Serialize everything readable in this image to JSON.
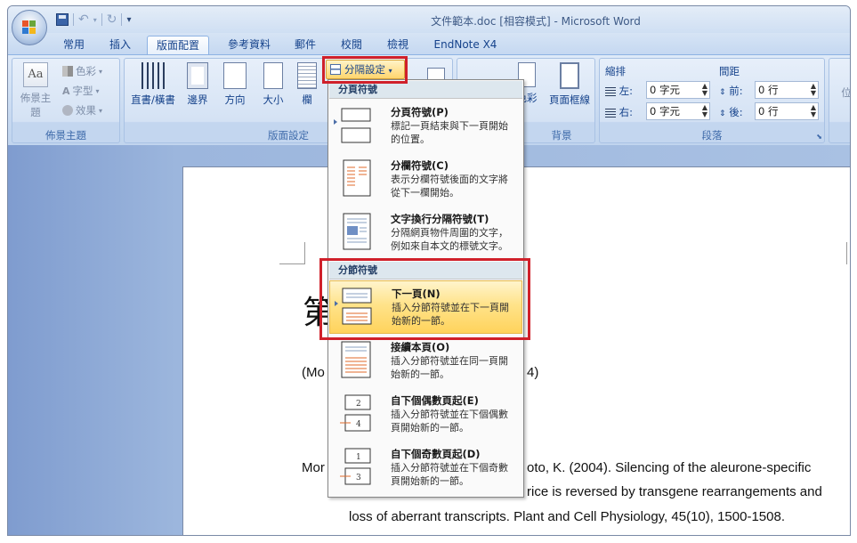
{
  "window": {
    "title": "文件範本.doc [相容模式] - Microsoft Word"
  },
  "qat": {
    "save_icon": "save-icon",
    "undo_icon": "undo-icon",
    "redo_icon": "redo-icon",
    "more": "▾"
  },
  "tabs": [
    {
      "label": "常用"
    },
    {
      "label": "插入"
    },
    {
      "label": "版面配置",
      "active": true
    },
    {
      "label": "參考資料"
    },
    {
      "label": "郵件"
    },
    {
      "label": "校閱"
    },
    {
      "label": "檢視"
    },
    {
      "label": "EndNote X4"
    }
  ],
  "ribbon": {
    "themes": {
      "label": "佈景主題",
      "theme_btn": "佈景主題",
      "colors": "色彩",
      "fonts": "字型",
      "effects": "效果"
    },
    "page_setup": {
      "label": "版面設定",
      "orientation": "直書/橫書",
      "margins": "邊界",
      "direction": "方向",
      "size": "大小",
      "columns": "欄",
      "breaks": "分隔設定"
    },
    "background": {
      "label": "背景",
      "page_color": "色彩",
      "page_borders": "頁面框線"
    },
    "paragraph": {
      "label": "段落",
      "indent_label": "縮排",
      "spacing_label": "間距",
      "left_label": "左:",
      "left_value": "0 字元",
      "right_label": "右:",
      "right_value": "0 字元",
      "before_label": "前:",
      "before_value": "0 行",
      "after_label": "後:",
      "after_value": "0 行"
    },
    "arrange_cut": "位"
  },
  "menu": {
    "page_breaks_header": "分頁符號",
    "section_breaks_header": "分節符號",
    "items": [
      {
        "title": "分頁符號(P)",
        "desc": "標記一頁結束與下一頁開始\n的位置。",
        "icon": "page-break-icon"
      },
      {
        "title": "分欄符號(C)",
        "desc": "表示分欄符號後面的文字將\n從下一欄開始。",
        "icon": "column-break-icon"
      },
      {
        "title": "文字換行分隔符號(T)",
        "desc": "分隔網頁物件周圍的文字，\n例如來自本文的標號文字。",
        "icon": "text-wrapping-break-icon"
      },
      {
        "title": "下一頁(N)",
        "desc": "插入分節符號並在下一頁開\n始新的一節。",
        "icon": "next-page-break-icon"
      },
      {
        "title": "接續本頁(O)",
        "desc": "插入分節符號並在同一頁開\n始新的一節。",
        "icon": "continuous-break-icon"
      },
      {
        "title": "自下個偶數頁起(E)",
        "desc": "插入分節符號並在下個偶數\n頁開始新的一節。",
        "icon": "even-page-break-icon"
      },
      {
        "title": "自下個奇數頁起(D)",
        "desc": "插入分節符號並在下個奇數\n頁開始新的一節。",
        "icon": "odd-page-break-icon"
      }
    ]
  },
  "document": {
    "heading_fragment": "第",
    "citation_left": "(Mo",
    "citation_right": "4)",
    "ref_line1_left": "Mor",
    "ref_line1_right": "oto, K. (2004). Silencing of the aleurone-specific",
    "ref_line2_right": "rice is reversed by transgene rearrangements and",
    "ref_line3": "loss of aberrant transcripts. Plant and Cell Physiology, 45(10), 1500-1508."
  },
  "colors": {
    "accent": "#15428b",
    "highlight": "#ffd35c",
    "annotation": "#d0202a"
  }
}
